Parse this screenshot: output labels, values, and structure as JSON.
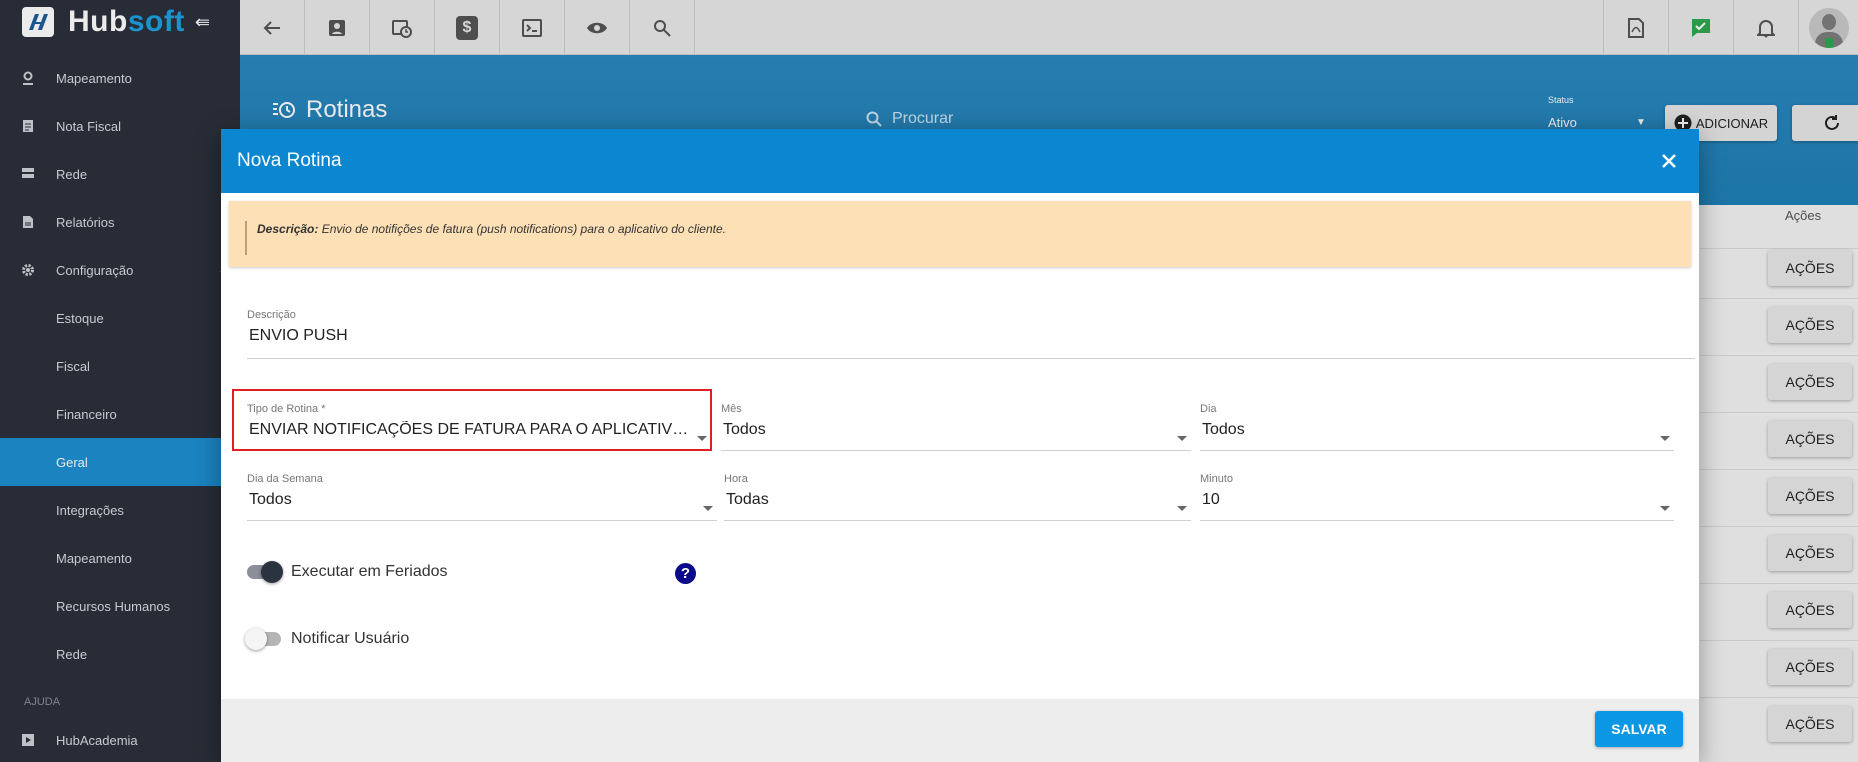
{
  "brand": {
    "hub": "Hub",
    "soft": "soft"
  },
  "sidebar": {
    "items": [
      {
        "label": "Mapeamento",
        "icon": "map-pin-icon"
      },
      {
        "label": "Nota Fiscal",
        "icon": "invoice-icon"
      },
      {
        "label": "Rede",
        "icon": "server-icon"
      },
      {
        "label": "Relatórios",
        "icon": "report-icon"
      },
      {
        "label": "Configuração",
        "icon": "gear-icon"
      }
    ],
    "sub_items": [
      "Estoque",
      "Fiscal",
      "Financeiro",
      "Geral",
      "Integrações",
      "Mapeamento",
      "Recursos Humanos",
      "Rede"
    ],
    "active_sub": "Geral",
    "section_help": "AJUDA",
    "help_items": [
      {
        "label": "HubAcademia",
        "icon": "play-icon"
      }
    ]
  },
  "page": {
    "title": "Rotinas",
    "search_placeholder": "Procurar",
    "status_label": "Status",
    "status_value": "Ativo",
    "add_label": "ADICIONAR",
    "actions_header": "Ações",
    "row_action_label": "AÇÕES"
  },
  "modal": {
    "title": "Nova Rotina",
    "notice_label": "Descrição:",
    "notice_text": "Envio de notifições de fatura (push notifications) para o aplicativo do cliente.",
    "descricao_label": "Descrição",
    "descricao_value": "ENVIO PUSH",
    "tipo_label": "Tipo de Rotina *",
    "tipo_value": "ENVIAR NOTIFICAÇÕES DE FATURA PARA O APLICATIVO DO CLIENTE",
    "mes_label": "Mês",
    "mes_value": "Todos",
    "dia_label": "Dia",
    "dia_value": "Todos",
    "dia_semana_label": "Dia da Semana",
    "dia_semana_value": "Todos",
    "hora_label": "Hora",
    "hora_value": "Todas",
    "minuto_label": "Minuto",
    "minuto_value": "10",
    "feriados_label": "Executar em Feriados",
    "feriados_on": true,
    "notificar_label": "Notificar Usuário",
    "notificar_on": false,
    "save_label": "SALVAR"
  },
  "colors": {
    "sidebar_bg": "#2b303b",
    "active_item": "#1e8fd1",
    "header_blue": "#0b86d1",
    "notice_bg": "#fde0b6",
    "save_blue": "#0b97e4",
    "highlight": "#e02020"
  }
}
